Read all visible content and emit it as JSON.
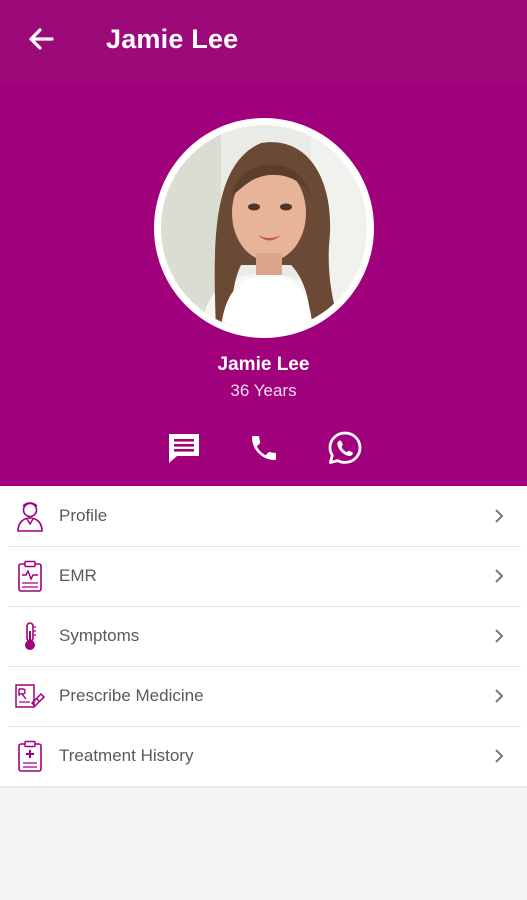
{
  "app_bar": {
    "title": "Jamie Lee",
    "back_icon": "arrow-left-icon",
    "background": "#9c0a7a"
  },
  "profile": {
    "name": "Jamie Lee",
    "age": "36 Years",
    "background": "#a0007c"
  },
  "quick_actions": [
    {
      "icon": "message-icon"
    },
    {
      "icon": "phone-icon"
    },
    {
      "icon": "whatsapp-icon"
    }
  ],
  "menu": {
    "items": [
      {
        "label": "Profile",
        "icon": "person-icon"
      },
      {
        "label": "EMR",
        "icon": "clipboard-chart-icon"
      },
      {
        "label": "Symptoms",
        "icon": "thermometer-icon"
      },
      {
        "label": "Prescribe Medicine",
        "icon": "prescription-icon"
      },
      {
        "label": "Treatment History",
        "icon": "medical-record-icon"
      }
    ],
    "accent_color": "#a0007c",
    "chevron_icon": "chevron-right-icon"
  }
}
